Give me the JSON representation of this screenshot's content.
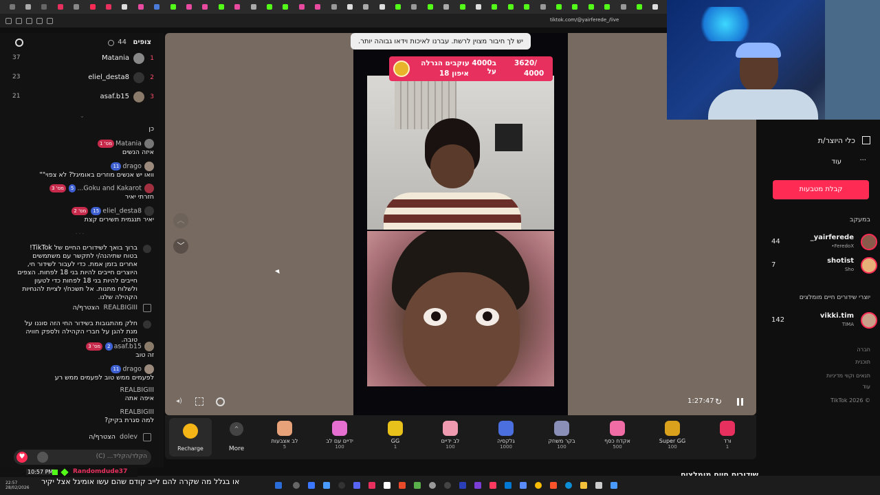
{
  "browser": {
    "url": "tiktok.com/@yairferede_/live"
  },
  "viewers": {
    "title": "צופים",
    "count": "44",
    "top": [
      {
        "rank": "1",
        "name": "Matania",
        "points": "37"
      },
      {
        "rank": "2",
        "name": "eliel_desta8",
        "points": "23"
      },
      {
        "rank": "3",
        "name": "asaf.b15",
        "points": "21"
      }
    ]
  },
  "chat": {
    "m0": {
      "text": "כן"
    },
    "m1": {
      "user": "Matania",
      "badge": "מס' 1",
      "text": "איזה הנשים"
    },
    "m2": {
      "user": "drago",
      "badge": "11",
      "text": "וואו יש אנשים מוזרים באומיגל? לא צפוי\"\""
    },
    "m3": {
      "user": "Goku and Kakarot...",
      "badge": "5",
      "badge2": "מס' 3",
      "text": "חזרתי יאיר"
    },
    "m4": {
      "user": "eliel_desta8",
      "badge": "15",
      "badge2": "מס' 2",
      "text": "יאיר תנגמית תשירים קצת"
    },
    "m5": {
      "text": "ברוך בואך לשידורים החיים של TikTok! בטוח שתיהנה/י לתקשר עם משתמשים אחרים בזמן אמת. כדי לעבור לשידור חי, היוצרים חייבים להיות בני 18 לפחות. הצפים חייבים להיות בני 18 לפחות כדי לטעון ולשלוח מתנות. אל תשכח/י לציית להנחיות הקהילה שלנו."
    },
    "m6": {
      "user": "REALBIGIII",
      "text": "הצטרף/ה"
    },
    "m7": {
      "text": "חלק מהתגובות בשידור החי הזה סוננו על מנת להגן על חברי הקהילה ולספק חוויה טובה."
    },
    "m8": {
      "user": "asaf.b15",
      "badge": "2",
      "badge2": "מס' 3",
      "text": "זה טוב"
    },
    "m9": {
      "user": "drago",
      "badge": "11",
      "text": "לפעמים ממש טוב לפעמים ממש רע"
    },
    "m10": {
      "user": "REALBIGIII",
      "text": "איפה אתה"
    },
    "m11": {
      "user": "REALBIGIII",
      "text": "למה סגרת בקיק?"
    },
    "m12": {
      "user": "dolev",
      "text": "הצטרף/ה"
    },
    "input_placeholder": "הקלד/הקליד... (C)"
  },
  "stage": {
    "toast": "יש לך חיבור מצוין לרשת. עברנו לאיכות וידאו גבוהה יותר.",
    "goal_line1": "ב4000 עוקבים הגרלה על",
    "goal_line2": "איפון 18",
    "goal_progress": "3620/",
    "goal_target": "4000",
    "timer": "1:27:47"
  },
  "gifts": [
    {
      "name": "ורד",
      "price": "1"
    },
    {
      "name": "Super GG",
      "price": "100"
    },
    {
      "name": "אקדח כסף",
      "price": "500"
    },
    {
      "name": "בקר משחק",
      "price": "100"
    },
    {
      "name": "גלקסיה",
      "price": "1000"
    },
    {
      "name": "לב ידיים",
      "price": "100"
    },
    {
      "name": "GG",
      "price": "1"
    },
    {
      "name": "ידיים עם לב",
      "price": "100"
    },
    {
      "name": "לב אצבעות",
      "price": "5"
    }
  ],
  "controls": {
    "more": "More",
    "recharge": "Recharge"
  },
  "sidebar": {
    "creator_tools": "כלי היוצר/ת",
    "more": "עוד",
    "get_coins": "קבלת מטבעות",
    "following_title": "במעקב",
    "following": [
      {
        "name": "yairferede_",
        "sub": "FeredoX•",
        "viewers": "44"
      },
      {
        "name": "shotist",
        "sub": "Sho",
        "viewers": "7"
      }
    ],
    "recommended_title": "יוצרי שידורים חיים מומלצים",
    "recommended": [
      {
        "name": "vikki.tim",
        "sub": "TIMA",
        "viewers": "142"
      }
    ],
    "footer": [
      "חברה",
      "תוכנית",
      "תנאים וקווי מדיניות",
      "עוד"
    ],
    "copyright": "TikTok 2026 ©",
    "bottom_heading": "שידורים חיים מומלצים"
  },
  "stream_overlay": {
    "subtitle": "או בגלל מה שקרה להם לייב קודם שהם עשו אומיגל אצל יקיר",
    "clock": "10:57 PM",
    "username": "Randomdude37"
  },
  "taskbar": {
    "time": "22:57",
    "date": "28/02/2026"
  }
}
